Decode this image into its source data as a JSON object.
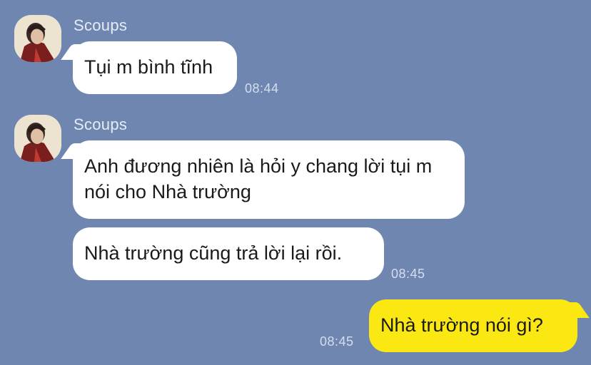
{
  "messages": [
    {
      "sender": "Scoups",
      "text": "Tụi m bình tĩnh",
      "time": "08:44"
    },
    {
      "sender": "Scoups",
      "text": "Anh đương nhiên là hỏi y chang lời tụi m nói cho Nhà trường"
    },
    {
      "text": "Nhà trường cũng trả lời lại rồi.",
      "time": "08:45"
    },
    {
      "text": "Nhà trường nói gì?",
      "time": "08:45",
      "mine": true
    }
  ],
  "colors": {
    "background": "#6f86b0",
    "incoming_bubble": "#ffffff",
    "outgoing_bubble": "#fbe813"
  },
  "icons": {
    "avatar": "avatar-photo"
  }
}
